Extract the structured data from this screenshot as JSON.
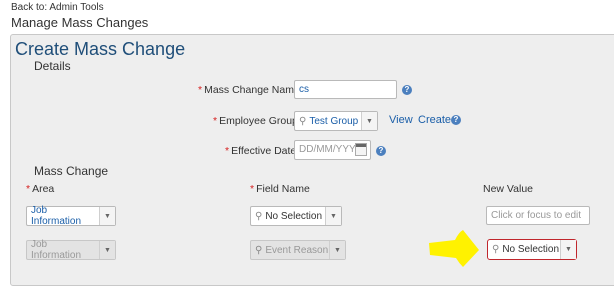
{
  "nav": {
    "back_link": "Back to: Admin Tools"
  },
  "page": {
    "title": "Manage Mass Changes"
  },
  "panel": {
    "title": "Create Mass Change"
  },
  "details": {
    "heading": "Details",
    "mass_change_name": {
      "label": "Mass Change Name",
      "value": "cs"
    },
    "employee_group": {
      "label": "Employee Group",
      "value": "Test Group",
      "view_link": "View",
      "create_link": "Create"
    },
    "effective_date": {
      "label": "Effective Date",
      "placeholder": "DD/MM/YYYY"
    }
  },
  "mass_change": {
    "heading": "Mass Change",
    "col_area": "Area",
    "col_field_name": "Field Name",
    "col_new_value": "New Value",
    "row1": {
      "area": "Job Information",
      "field_name": "No Selection",
      "new_value_placeholder": "Click or focus to edit"
    },
    "row2": {
      "area": "Job Information",
      "field_name": "Event Reason",
      "new_value": "No Selection"
    }
  },
  "required_marker": "*",
  "help_glyph": "?",
  "colors": {
    "accent": "#1a5ea8",
    "required": "#d62020",
    "highlight_border": "#c0262c",
    "annotation_arrow": "#fff200"
  }
}
